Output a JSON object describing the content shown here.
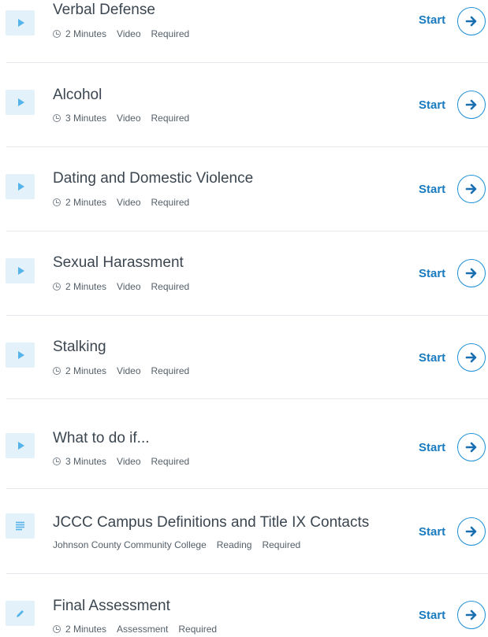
{
  "items": [
    {
      "title": "Verbal Defense",
      "meta": [
        "2 Minutes",
        "Video",
        "Required"
      ],
      "icon": "play-icon",
      "has_clock": true,
      "action": "Start"
    },
    {
      "title": "Alcohol",
      "meta": [
        "3 Minutes",
        "Video",
        "Required"
      ],
      "icon": "play-icon",
      "has_clock": true,
      "action": "Start"
    },
    {
      "title": "Dating and Domestic Violence",
      "meta": [
        "2 Minutes",
        "Video",
        "Required"
      ],
      "icon": "play-icon",
      "has_clock": true,
      "action": "Start"
    },
    {
      "title": "Sexual Harassment",
      "meta": [
        "2 Minutes",
        "Video",
        "Required"
      ],
      "icon": "play-icon",
      "has_clock": true,
      "action": "Start"
    },
    {
      "title": "Stalking",
      "meta": [
        "2 Minutes",
        "Video",
        "Required"
      ],
      "icon": "play-icon",
      "has_clock": true,
      "action": "Start"
    },
    {
      "title": "What to do if...",
      "meta": [
        "3 Minutes",
        "Video",
        "Required"
      ],
      "icon": "play-icon",
      "has_clock": true,
      "action": "Start"
    },
    {
      "title": "JCCC Campus Definitions and Title IX Contacts",
      "meta": [
        "Johnson County Community College",
        "Reading",
        "Required"
      ],
      "icon": "text-lines-icon",
      "has_clock": false,
      "action": "Start"
    },
    {
      "title": "Final Assessment",
      "meta": [
        "2 Minutes",
        "Assessment",
        "Required"
      ],
      "icon": "pencil-icon",
      "has_clock": true,
      "action": "Start"
    }
  ],
  "colors": {
    "accent": "#1a7bbf",
    "icon_bg": "#e3f1fb",
    "icon_fg": "#55b4ea",
    "divider": "#e3e6ea"
  }
}
